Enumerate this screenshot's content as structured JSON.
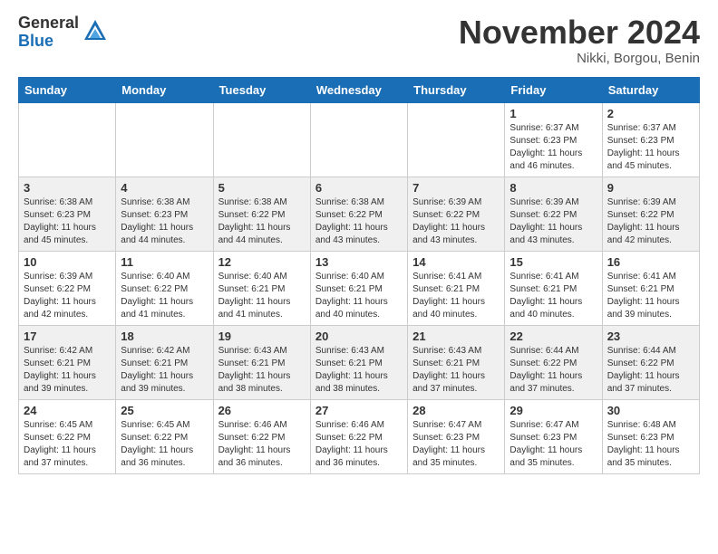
{
  "header": {
    "logo_general": "General",
    "logo_blue": "Blue",
    "month_title": "November 2024",
    "location": "Nikki, Borgou, Benin"
  },
  "weekdays": [
    "Sunday",
    "Monday",
    "Tuesday",
    "Wednesday",
    "Thursday",
    "Friday",
    "Saturday"
  ],
  "weeks": [
    [
      {
        "day": "",
        "info": ""
      },
      {
        "day": "",
        "info": ""
      },
      {
        "day": "",
        "info": ""
      },
      {
        "day": "",
        "info": ""
      },
      {
        "day": "",
        "info": ""
      },
      {
        "day": "1",
        "info": "Sunrise: 6:37 AM\nSunset: 6:23 PM\nDaylight: 11 hours\nand 46 minutes."
      },
      {
        "day": "2",
        "info": "Sunrise: 6:37 AM\nSunset: 6:23 PM\nDaylight: 11 hours\nand 45 minutes."
      }
    ],
    [
      {
        "day": "3",
        "info": "Sunrise: 6:38 AM\nSunset: 6:23 PM\nDaylight: 11 hours\nand 45 minutes."
      },
      {
        "day": "4",
        "info": "Sunrise: 6:38 AM\nSunset: 6:23 PM\nDaylight: 11 hours\nand 44 minutes."
      },
      {
        "day": "5",
        "info": "Sunrise: 6:38 AM\nSunset: 6:22 PM\nDaylight: 11 hours\nand 44 minutes."
      },
      {
        "day": "6",
        "info": "Sunrise: 6:38 AM\nSunset: 6:22 PM\nDaylight: 11 hours\nand 43 minutes."
      },
      {
        "day": "7",
        "info": "Sunrise: 6:39 AM\nSunset: 6:22 PM\nDaylight: 11 hours\nand 43 minutes."
      },
      {
        "day": "8",
        "info": "Sunrise: 6:39 AM\nSunset: 6:22 PM\nDaylight: 11 hours\nand 43 minutes."
      },
      {
        "day": "9",
        "info": "Sunrise: 6:39 AM\nSunset: 6:22 PM\nDaylight: 11 hours\nand 42 minutes."
      }
    ],
    [
      {
        "day": "10",
        "info": "Sunrise: 6:39 AM\nSunset: 6:22 PM\nDaylight: 11 hours\nand 42 minutes."
      },
      {
        "day": "11",
        "info": "Sunrise: 6:40 AM\nSunset: 6:22 PM\nDaylight: 11 hours\nand 41 minutes."
      },
      {
        "day": "12",
        "info": "Sunrise: 6:40 AM\nSunset: 6:21 PM\nDaylight: 11 hours\nand 41 minutes."
      },
      {
        "day": "13",
        "info": "Sunrise: 6:40 AM\nSunset: 6:21 PM\nDaylight: 11 hours\nand 40 minutes."
      },
      {
        "day": "14",
        "info": "Sunrise: 6:41 AM\nSunset: 6:21 PM\nDaylight: 11 hours\nand 40 minutes."
      },
      {
        "day": "15",
        "info": "Sunrise: 6:41 AM\nSunset: 6:21 PM\nDaylight: 11 hours\nand 40 minutes."
      },
      {
        "day": "16",
        "info": "Sunrise: 6:41 AM\nSunset: 6:21 PM\nDaylight: 11 hours\nand 39 minutes."
      }
    ],
    [
      {
        "day": "17",
        "info": "Sunrise: 6:42 AM\nSunset: 6:21 PM\nDaylight: 11 hours\nand 39 minutes."
      },
      {
        "day": "18",
        "info": "Sunrise: 6:42 AM\nSunset: 6:21 PM\nDaylight: 11 hours\nand 39 minutes."
      },
      {
        "day": "19",
        "info": "Sunrise: 6:43 AM\nSunset: 6:21 PM\nDaylight: 11 hours\nand 38 minutes."
      },
      {
        "day": "20",
        "info": "Sunrise: 6:43 AM\nSunset: 6:21 PM\nDaylight: 11 hours\nand 38 minutes."
      },
      {
        "day": "21",
        "info": "Sunrise: 6:43 AM\nSunset: 6:21 PM\nDaylight: 11 hours\nand 37 minutes."
      },
      {
        "day": "22",
        "info": "Sunrise: 6:44 AM\nSunset: 6:22 PM\nDaylight: 11 hours\nand 37 minutes."
      },
      {
        "day": "23",
        "info": "Sunrise: 6:44 AM\nSunset: 6:22 PM\nDaylight: 11 hours\nand 37 minutes."
      }
    ],
    [
      {
        "day": "24",
        "info": "Sunrise: 6:45 AM\nSunset: 6:22 PM\nDaylight: 11 hours\nand 37 minutes."
      },
      {
        "day": "25",
        "info": "Sunrise: 6:45 AM\nSunset: 6:22 PM\nDaylight: 11 hours\nand 36 minutes."
      },
      {
        "day": "26",
        "info": "Sunrise: 6:46 AM\nSunset: 6:22 PM\nDaylight: 11 hours\nand 36 minutes."
      },
      {
        "day": "27",
        "info": "Sunrise: 6:46 AM\nSunset: 6:22 PM\nDaylight: 11 hours\nand 36 minutes."
      },
      {
        "day": "28",
        "info": "Sunrise: 6:47 AM\nSunset: 6:23 PM\nDaylight: 11 hours\nand 35 minutes."
      },
      {
        "day": "29",
        "info": "Sunrise: 6:47 AM\nSunset: 6:23 PM\nDaylight: 11 hours\nand 35 minutes."
      },
      {
        "day": "30",
        "info": "Sunrise: 6:48 AM\nSunset: 6:23 PM\nDaylight: 11 hours\nand 35 minutes."
      }
    ]
  ]
}
